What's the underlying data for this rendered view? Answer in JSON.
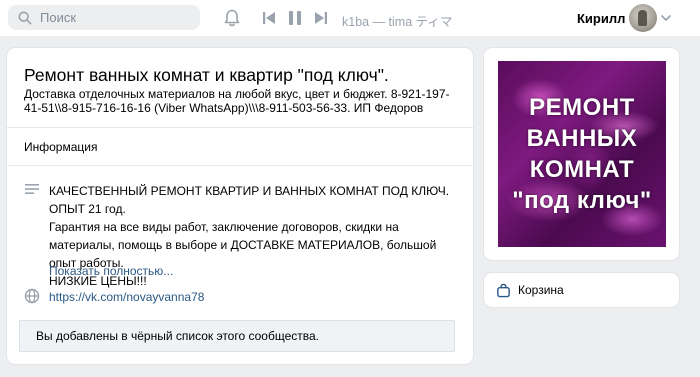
{
  "header": {
    "search_placeholder": "Поиск",
    "player_track": "k1ba — tima ティマ",
    "user_name": "Кирилл"
  },
  "community": {
    "title": "Ремонт ванных комнат и квартир \"под ключ\".",
    "status": "Доставка отделочных материалов на любой вкус, цвет и бюджет. 8-921-197-41-51\\\\8-915-716-16-16 (Viber WhatsApp)\\\\\\8-911-503-56-33. ИП Федоров",
    "info_heading": "Информация",
    "description_lines": [
      "КАЧЕСТВЕННЫЙ РЕМОНТ КВАРТИР И ВАННЫХ КОМНАТ ПОД КЛЮЧ. ОПЫТ 21 год.",
      "Гарантия на все виды работ, заключение договоров, скидки на материалы, помощь в выборе и ДОСТАВКЕ МАТЕРИАЛОВ, большой опыт работы.",
      "НИЗКИЕ ЦЕНЫ!!!"
    ],
    "show_more": "Показать полностью...",
    "website": "https://vk.com/novayvanna78",
    "blacklist_notice": "Вы добавлены в чёрный список этого сообщества."
  },
  "cover": {
    "lines": [
      "РЕМОНТ",
      "ВАННЫХ",
      "КОМНАТ",
      "\"под ключ\""
    ]
  },
  "sidebar": {
    "cart_label": "Корзина"
  },
  "colors": {
    "link": "#2a5885",
    "background": "#edeef0",
    "icon": "#99a2ad"
  }
}
